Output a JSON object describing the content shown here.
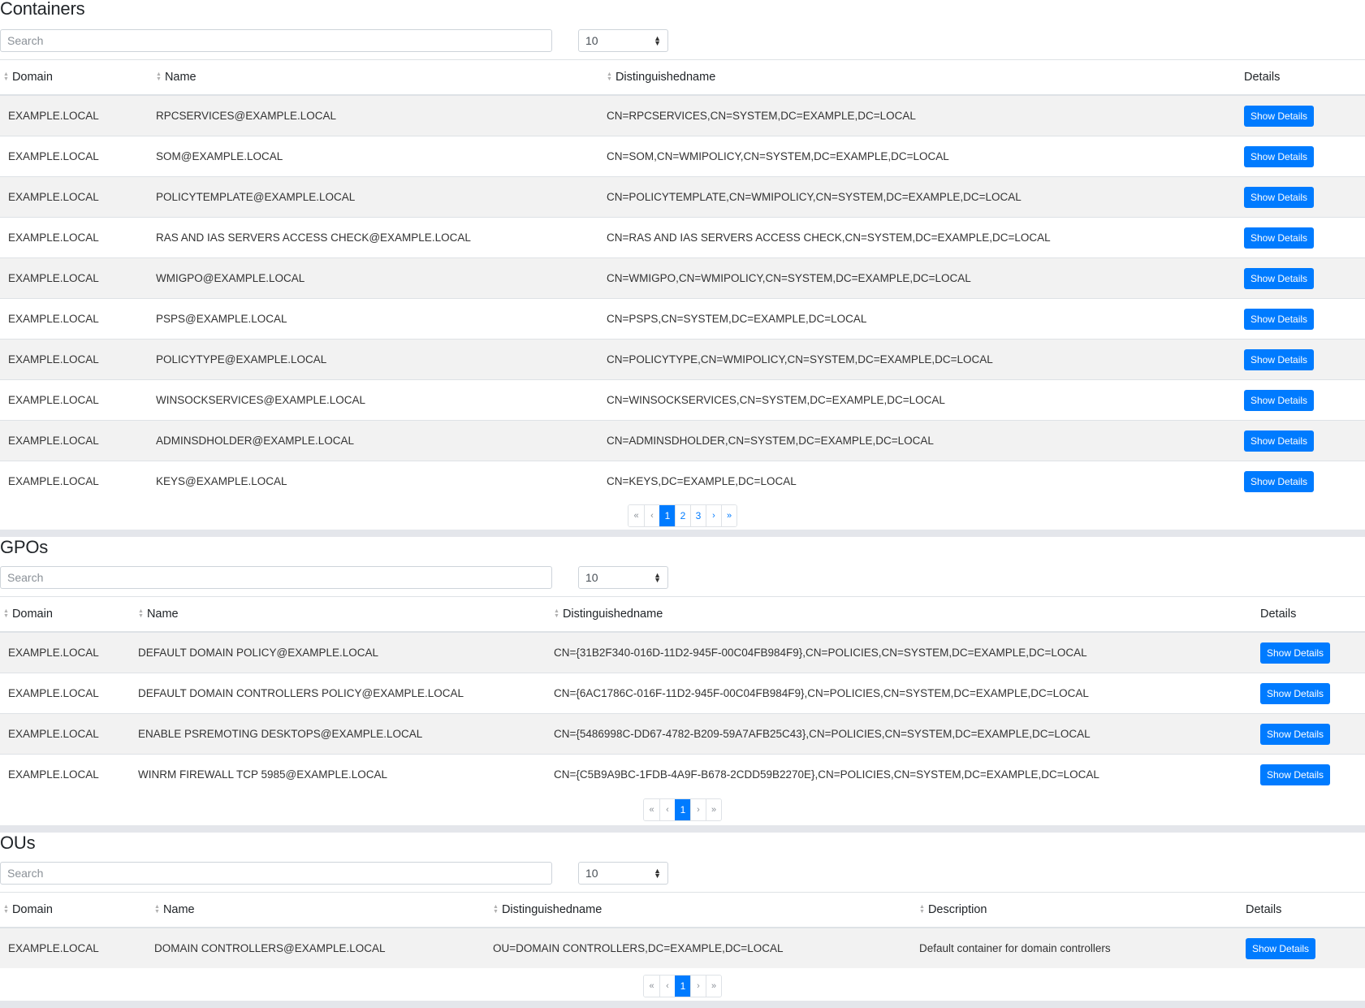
{
  "sort_icon": "sort-icon",
  "button_color": "#007bff",
  "sections": {
    "containers": {
      "title": "Containers",
      "search_placeholder": "Search",
      "page_size": "10",
      "columns": [
        "Domain",
        "Name",
        "Distinguishedname",
        "Details"
      ],
      "rows": [
        {
          "domain": "EXAMPLE.LOCAL",
          "name": "RPCSERVICES@EXAMPLE.LOCAL",
          "dn": "CN=RPCSERVICES,CN=SYSTEM,DC=EXAMPLE,DC=LOCAL",
          "action": "Show Details"
        },
        {
          "domain": "EXAMPLE.LOCAL",
          "name": "SOM@EXAMPLE.LOCAL",
          "dn": "CN=SOM,CN=WMIPOLICY,CN=SYSTEM,DC=EXAMPLE,DC=LOCAL",
          "action": "Show Details"
        },
        {
          "domain": "EXAMPLE.LOCAL",
          "name": "POLICYTEMPLATE@EXAMPLE.LOCAL",
          "dn": "CN=POLICYTEMPLATE,CN=WMIPOLICY,CN=SYSTEM,DC=EXAMPLE,DC=LOCAL",
          "action": "Show Details"
        },
        {
          "domain": "EXAMPLE.LOCAL",
          "name": "RAS AND IAS SERVERS ACCESS CHECK@EXAMPLE.LOCAL",
          "dn": "CN=RAS AND IAS SERVERS ACCESS CHECK,CN=SYSTEM,DC=EXAMPLE,DC=LOCAL",
          "action": "Show Details"
        },
        {
          "domain": "EXAMPLE.LOCAL",
          "name": "WMIGPO@EXAMPLE.LOCAL",
          "dn": "CN=WMIGPO,CN=WMIPOLICY,CN=SYSTEM,DC=EXAMPLE,DC=LOCAL",
          "action": "Show Details"
        },
        {
          "domain": "EXAMPLE.LOCAL",
          "name": "PSPS@EXAMPLE.LOCAL",
          "dn": "CN=PSPS,CN=SYSTEM,DC=EXAMPLE,DC=LOCAL",
          "action": "Show Details"
        },
        {
          "domain": "EXAMPLE.LOCAL",
          "name": "POLICYTYPE@EXAMPLE.LOCAL",
          "dn": "CN=POLICYTYPE,CN=WMIPOLICY,CN=SYSTEM,DC=EXAMPLE,DC=LOCAL",
          "action": "Show Details"
        },
        {
          "domain": "EXAMPLE.LOCAL",
          "name": "WINSOCKSERVICES@EXAMPLE.LOCAL",
          "dn": "CN=WINSOCKSERVICES,CN=SYSTEM,DC=EXAMPLE,DC=LOCAL",
          "action": "Show Details"
        },
        {
          "domain": "EXAMPLE.LOCAL",
          "name": "ADMINSDHOLDER@EXAMPLE.LOCAL",
          "dn": "CN=ADMINSDHOLDER,CN=SYSTEM,DC=EXAMPLE,DC=LOCAL",
          "action": "Show Details"
        },
        {
          "domain": "EXAMPLE.LOCAL",
          "name": "KEYS@EXAMPLE.LOCAL",
          "dn": "CN=KEYS,DC=EXAMPLE,DC=LOCAL",
          "action": "Show Details"
        }
      ],
      "pagination": {
        "first": "«",
        "prev": "‹",
        "pages": [
          "1",
          "2",
          "3"
        ],
        "current": "1",
        "next": "›",
        "last": "»"
      }
    },
    "gpos": {
      "title": "GPOs",
      "search_placeholder": "Search",
      "page_size": "10",
      "columns": [
        "Domain",
        "Name",
        "Distinguishedname",
        "Details"
      ],
      "rows": [
        {
          "domain": "EXAMPLE.LOCAL",
          "name": "DEFAULT DOMAIN POLICY@EXAMPLE.LOCAL",
          "dn": "CN={31B2F340-016D-11D2-945F-00C04FB984F9},CN=POLICIES,CN=SYSTEM,DC=EXAMPLE,DC=LOCAL",
          "action": "Show Details"
        },
        {
          "domain": "EXAMPLE.LOCAL",
          "name": "DEFAULT DOMAIN CONTROLLERS POLICY@EXAMPLE.LOCAL",
          "dn": "CN={6AC1786C-016F-11D2-945F-00C04FB984F9},CN=POLICIES,CN=SYSTEM,DC=EXAMPLE,DC=LOCAL",
          "action": "Show Details"
        },
        {
          "domain": "EXAMPLE.LOCAL",
          "name": "ENABLE PSREMOTING DESKTOPS@EXAMPLE.LOCAL",
          "dn": "CN={5486998C-DD67-4782-B209-59A7AFB25C43},CN=POLICIES,CN=SYSTEM,DC=EXAMPLE,DC=LOCAL",
          "action": "Show Details"
        },
        {
          "domain": "EXAMPLE.LOCAL",
          "name": "WINRM FIREWALL TCP 5985@EXAMPLE.LOCAL",
          "dn": "CN={C5B9A9BC-1FDB-4A9F-B678-2CDD59B2270E},CN=POLICIES,CN=SYSTEM,DC=EXAMPLE,DC=LOCAL",
          "action": "Show Details"
        }
      ],
      "pagination": {
        "first": "«",
        "prev": "‹",
        "pages": [
          "1"
        ],
        "current": "1",
        "next": "›",
        "last": "»"
      }
    },
    "ous": {
      "title": "OUs",
      "search_placeholder": "Search",
      "page_size": "10",
      "columns": [
        "Domain",
        "Name",
        "Distinguishedname",
        "Description",
        "Details"
      ],
      "rows": [
        {
          "domain": "EXAMPLE.LOCAL",
          "name": "DOMAIN CONTROLLERS@EXAMPLE.LOCAL",
          "dn": "OU=DOMAIN CONTROLLERS,DC=EXAMPLE,DC=LOCAL",
          "description": "Default container for domain controllers",
          "action": "Show Details"
        }
      ],
      "pagination": {
        "first": "«",
        "prev": "‹",
        "pages": [
          "1"
        ],
        "current": "1",
        "next": "›",
        "last": "»"
      }
    }
  }
}
